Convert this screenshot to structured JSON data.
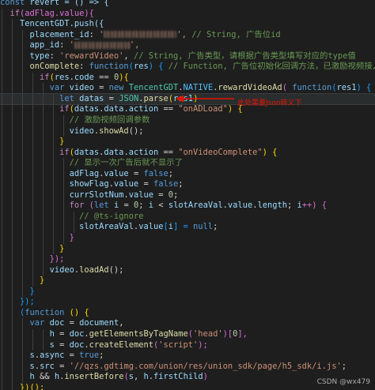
{
  "editor": {
    "language": "javascript",
    "theme": "dark",
    "annotation": {
      "text": "此处需要Json转义下",
      "color": "#e51400"
    },
    "watermark": "CSDN @wx479",
    "masked_values": [
      "placement_id",
      "app_id"
    ]
  },
  "code": {
    "l1": [
      "const",
      " revert = () => {"
    ],
    "l2": [
      "if",
      "(adFlag.value){"
    ],
    "l3": [
      "TencentGDT.push({"
    ],
    "l4": [
      "placement_id",
      ": ",
      "'",
      "', ",
      "// String, 广告位id"
    ],
    "l5": [
      "app_id",
      ": ",
      "'",
      "',"
    ],
    "l6": [
      "type",
      ": ",
      "'rewardVideo'",
      ", ",
      "// String, 广告类型，请根据广告类型填写对应的type值"
    ],
    "l7": [
      "onComplete",
      ": ",
      "function",
      "(",
      "res",
      ") { ",
      "// Function, 广告位初始化回调方法，已激励视频接入为例"
    ],
    "l8": [
      "if",
      "(",
      "res",
      ".",
      "code",
      " == ",
      "0",
      "){"
    ],
    "l9": [
      "var",
      " ",
      "video",
      " = ",
      "new",
      " ",
      "TencentGDT",
      ".",
      "NATIVE",
      ".",
      "rewardVideoAd",
      "( ",
      "function",
      "(",
      "res1",
      ") {"
    ],
    "l10": [
      "let",
      " ",
      "datas",
      " = ",
      "JSON",
      ".",
      "parse",
      "(",
      "res1",
      ")"
    ],
    "l11": [
      "if",
      "(",
      "datas",
      ".",
      "data",
      ".",
      "action",
      " == ",
      "\"onADLoad\"",
      ") {"
    ],
    "l12": [
      "// 激励视频回调参数"
    ],
    "l13": [
      "video",
      ".",
      "showAd",
      "();"
    ],
    "l14": [
      "}"
    ],
    "l15": [
      "if",
      "(",
      "datas",
      ".",
      "data",
      ".",
      "action",
      " == ",
      "\"onVideoComplete\"",
      ") {"
    ],
    "l16": [
      "// 显示一次广告后就不显示了"
    ],
    "l17": [
      "adFlag",
      ".",
      "value",
      " = ",
      "false",
      ";"
    ],
    "l18": [
      "showFlag",
      ".",
      "value",
      " = ",
      "false",
      ";"
    ],
    "l19": [
      "currSlotNum",
      ".",
      "value",
      " = ",
      "0",
      ";"
    ],
    "l20": [
      "for",
      " (",
      "let",
      " ",
      "i",
      " = ",
      "0",
      "; ",
      "i",
      " < ",
      "slotAreaVal",
      ".",
      "value",
      ".",
      "length",
      "; ",
      "i",
      "++) {"
    ],
    "l21": [
      "// @ts-ignore"
    ],
    "l22": [
      "slotAreaVal",
      ".",
      "value",
      "[",
      "i",
      "] = ",
      "null",
      ";"
    ],
    "l23": [
      "}"
    ],
    "l24": [
      "}"
    ],
    "l25": [
      "});"
    ],
    "l26": [
      "video",
      ".",
      "loadAd",
      "();"
    ],
    "l27": [
      "}"
    ],
    "l28": [
      "}"
    ],
    "l29": [
      "});"
    ],
    "l30": [
      "(",
      "function",
      " () {"
    ],
    "l31": [
      "var",
      " ",
      "doc",
      " = ",
      "document",
      ","
    ],
    "l32": [
      "h",
      " = ",
      "doc",
      ".",
      "getElementsByTagName",
      "(",
      "'head'",
      ")[",
      "0",
      "],"
    ],
    "l33": [
      "s",
      " = ",
      "doc",
      ".",
      "createElement",
      "(",
      "'script'",
      ");"
    ],
    "l34": [
      "s",
      ".",
      "async",
      " = ",
      "true",
      ";"
    ],
    "l35": [
      "s",
      ".",
      "src",
      " = ",
      "'//qzs.gdtimg.com/union/res/union_sdk/page/h5_sdk/i.js'",
      ";"
    ],
    "l36": [
      "h",
      " && ",
      "h",
      ".",
      "insertBefore",
      "(",
      "s",
      ", ",
      "h",
      ".",
      "firstChild",
      ")"
    ],
    "l37": [
      "})();"
    ],
    "l38": [
      "}"
    ]
  }
}
